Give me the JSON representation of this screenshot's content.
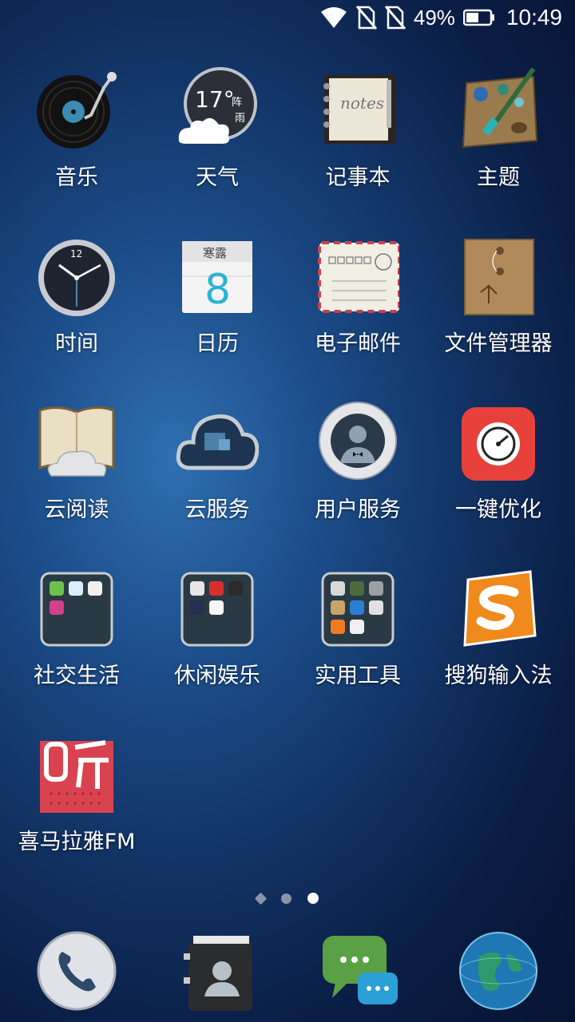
{
  "status_bar": {
    "battery_percent": "49%",
    "time": "10:49",
    "icons": [
      "wifi-icon",
      "sim-off-icon",
      "sim-off-icon",
      "battery-icon"
    ]
  },
  "apps": [
    {
      "label": "音乐",
      "icon": "music-vinyl-icon"
    },
    {
      "label": "天气",
      "icon": "weather-icon",
      "temp": "17°",
      "cond1": "阵",
      "cond2": "雨"
    },
    {
      "label": "记事本",
      "icon": "notes-icon",
      "notes_text": "notes"
    },
    {
      "label": "主题",
      "icon": "theme-palette-icon"
    },
    {
      "label": "时间",
      "icon": "clock-icon",
      "clock_12": "12"
    },
    {
      "label": "日历",
      "icon": "calendar-icon",
      "term": "寒露",
      "day": "8"
    },
    {
      "label": "电子邮件",
      "icon": "email-envelope-icon"
    },
    {
      "label": "文件管理器",
      "icon": "file-folder-icon"
    },
    {
      "label": "云阅读",
      "icon": "cloud-book-icon"
    },
    {
      "label": "云服务",
      "icon": "cloud-service-icon"
    },
    {
      "label": "用户服务",
      "icon": "user-service-icon"
    },
    {
      "label": "一键优化",
      "icon": "speedometer-icon"
    },
    {
      "label": "社交生活",
      "icon": "folder-icon"
    },
    {
      "label": "休闲娱乐",
      "icon": "folder-icon"
    },
    {
      "label": "实用工具",
      "icon": "folder-icon"
    },
    {
      "label": "搜狗输入法",
      "icon": "sogou-s-icon"
    },
    {
      "label": "喜马拉雅FM",
      "icon": "ximalaya-ting-icon"
    }
  ],
  "page_indicator": {
    "count": 3,
    "active": 2
  },
  "dock": [
    {
      "icon": "phone-icon"
    },
    {
      "icon": "contacts-icon"
    },
    {
      "icon": "messages-icon"
    },
    {
      "icon": "browser-globe-icon"
    }
  ],
  "colors": {
    "optimize_red": "#e8413c",
    "sogou_orange": "#f08a1c",
    "ximalaya_red": "#d9434f"
  }
}
